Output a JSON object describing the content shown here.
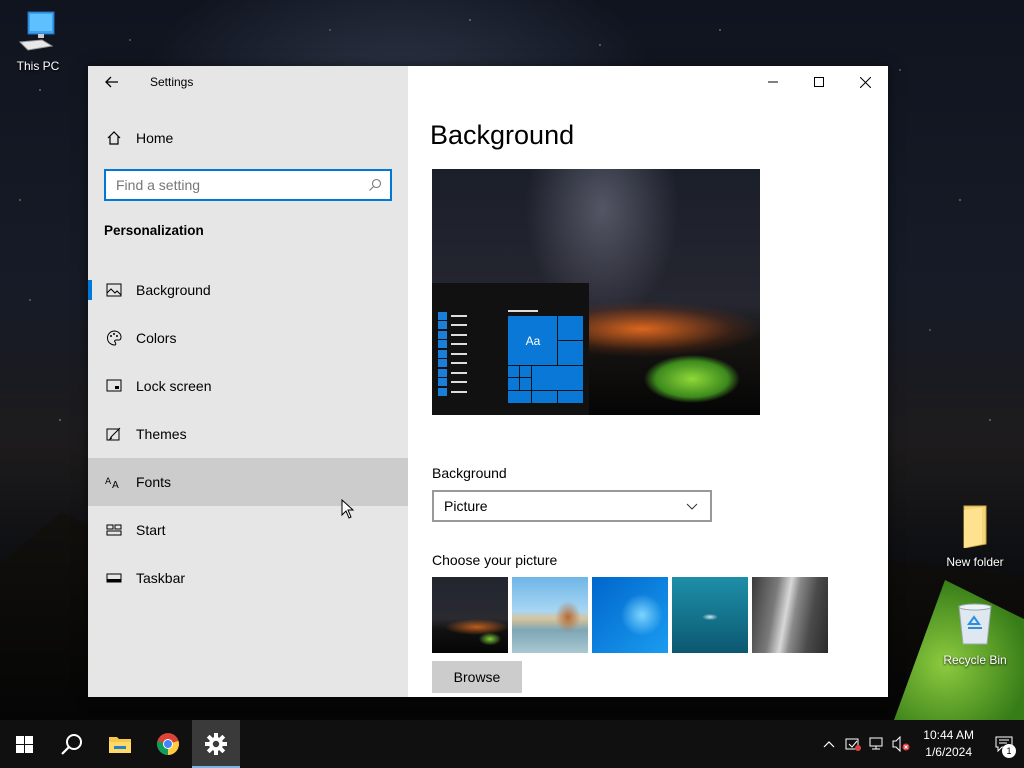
{
  "desktop": {
    "icons": [
      {
        "label": "This PC"
      },
      {
        "label": "New folder"
      },
      {
        "label": "Recycle Bin"
      }
    ]
  },
  "window": {
    "app_title": "Settings",
    "nav": {
      "home_label": "Home",
      "search_placeholder": "Find a setting",
      "section_title": "Personalization",
      "items": [
        {
          "label": "Background",
          "icon": "picture-icon",
          "selected": true
        },
        {
          "label": "Colors",
          "icon": "palette-icon"
        },
        {
          "label": "Lock screen",
          "icon": "lock-screen-icon"
        },
        {
          "label": "Themes",
          "icon": "themes-icon"
        },
        {
          "label": "Fonts",
          "icon": "fonts-icon",
          "hover": true
        },
        {
          "label": "Start",
          "icon": "start-icon"
        },
        {
          "label": "Taskbar",
          "icon": "taskbar-icon"
        }
      ]
    },
    "content": {
      "page_title": "Background",
      "preview_tile_text": "Aa",
      "background_label": "Background",
      "background_value": "Picture",
      "choose_label": "Choose your picture",
      "browse_label": "Browse"
    }
  },
  "taskbar": {
    "clock_time": "10:44 AM",
    "clock_date": "1/6/2024",
    "notification_count": "1"
  },
  "colors": {
    "accent": "#0078d7",
    "nav_bg": "#e6e6e6",
    "nav_hover": "#cccccc",
    "taskbar_bg": "#101010"
  }
}
